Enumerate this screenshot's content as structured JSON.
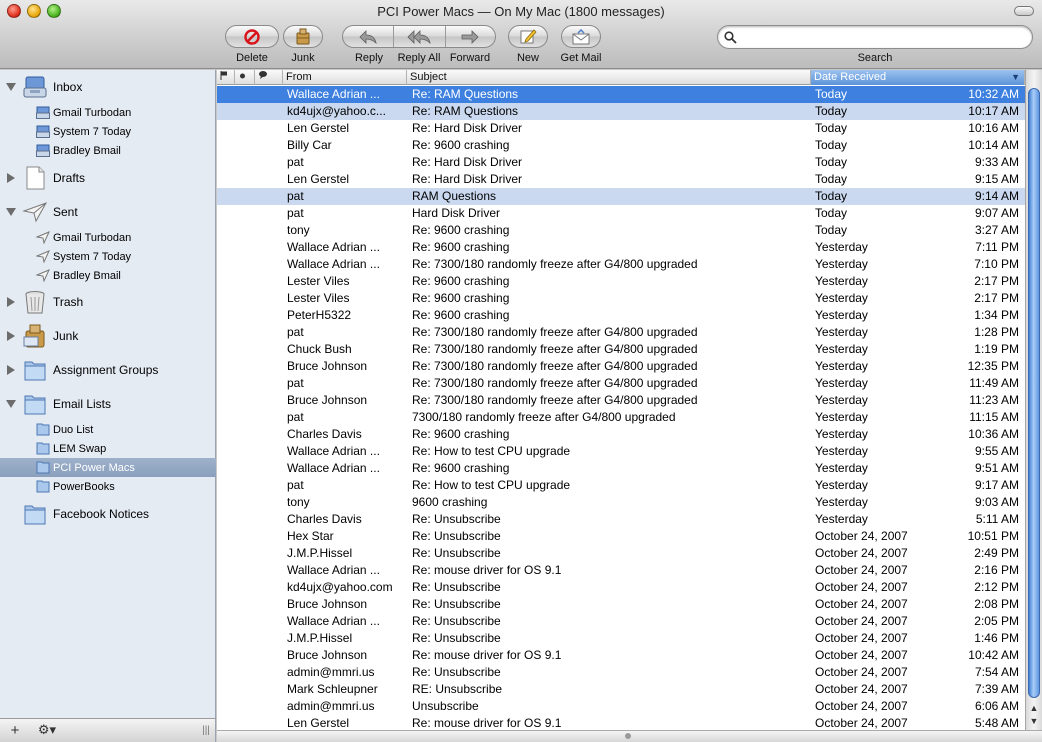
{
  "window": {
    "title": "PCI Power Macs — On My Mac (1800 messages)"
  },
  "toolbar": {
    "delete_label": "Delete",
    "junk_label": "Junk",
    "reply_label": "Reply",
    "reply_all_label": "Reply All",
    "forward_label": "Forward",
    "new_label": "New",
    "get_mail_label": "Get Mail",
    "search_label": "Search",
    "search_value": ""
  },
  "sidebar": {
    "inbox": "Inbox",
    "inbox_accounts": [
      "Gmail Turbodan",
      "System 7 Today",
      "Bradley Bmail"
    ],
    "drafts": "Drafts",
    "sent": "Sent",
    "sent_accounts": [
      "Gmail Turbodan",
      "System 7 Today",
      "Bradley Bmail"
    ],
    "trash": "Trash",
    "junk": "Junk",
    "assignment_groups": "Assignment Groups",
    "email_lists": "Email Lists",
    "email_list_items": [
      "Duo List",
      "LEM Swap",
      "PCI Power Macs",
      "PowerBooks"
    ],
    "selected_mailbox": "PCI Power Macs",
    "facebook_notices": "Facebook Notices"
  },
  "columns": {
    "from": "From",
    "subject": "Subject",
    "date_received": "Date Received"
  },
  "messages": [
    {
      "from": "Wallace Adrian ...",
      "subject": "Re: RAM Questions",
      "date": "Today",
      "time": "10:32 AM"
    },
    {
      "from": "kd4ujx@yahoo.c...",
      "subject": "Re: RAM Questions",
      "date": "Today",
      "time": "10:17 AM"
    },
    {
      "from": "Len Gerstel",
      "subject": "Re: Hard Disk Driver",
      "date": "Today",
      "time": "10:16 AM"
    },
    {
      "from": "Billy Car",
      "subject": "Re: 9600 crashing",
      "date": "Today",
      "time": "10:14 AM"
    },
    {
      "from": "pat",
      "subject": "Re: Hard Disk Driver",
      "date": "Today",
      "time": "9:33 AM"
    },
    {
      "from": "Len Gerstel",
      "subject": "Re: Hard Disk Driver",
      "date": "Today",
      "time": "9:15 AM"
    },
    {
      "from": "pat",
      "subject": "RAM Questions",
      "date": "Today",
      "time": "9:14 AM"
    },
    {
      "from": "pat",
      "subject": "Hard Disk Driver",
      "date": "Today",
      "time": "9:07 AM"
    },
    {
      "from": "tony",
      "subject": "Re: 9600 crashing",
      "date": "Today",
      "time": "3:27 AM"
    },
    {
      "from": "Wallace Adrian ...",
      "subject": "Re: 9600 crashing",
      "date": "Yesterday",
      "time": "7:11 PM"
    },
    {
      "from": "Wallace Adrian ...",
      "subject": "Re: 7300/180 randomly freeze after G4/800 upgraded",
      "date": "Yesterday",
      "time": "7:10 PM"
    },
    {
      "from": "Lester Viles",
      "subject": "Re: 9600 crashing",
      "date": "Yesterday",
      "time": "2:17 PM"
    },
    {
      "from": "Lester Viles",
      "subject": "Re: 9600 crashing",
      "date": "Yesterday",
      "time": "2:17 PM"
    },
    {
      "from": "PeterH5322",
      "subject": "Re: 9600 crashing",
      "date": "Yesterday",
      "time": "1:34 PM"
    },
    {
      "from": "pat",
      "subject": "Re: 7300/180 randomly freeze after G4/800 upgraded",
      "date": "Yesterday",
      "time": "1:28 PM"
    },
    {
      "from": "Chuck Bush",
      "subject": "Re: 7300/180 randomly freeze after G4/800 upgraded",
      "date": "Yesterday",
      "time": "1:19 PM"
    },
    {
      "from": "Bruce Johnson",
      "subject": "Re: 7300/180 randomly freeze after G4/800 upgraded",
      "date": "Yesterday",
      "time": "12:35 PM"
    },
    {
      "from": "pat",
      "subject": "Re: 7300/180 randomly freeze after G4/800 upgraded",
      "date": "Yesterday",
      "time": "11:49 AM"
    },
    {
      "from": "Bruce Johnson",
      "subject": "Re: 7300/180 randomly freeze after G4/800 upgraded",
      "date": "Yesterday",
      "time": "11:23 AM"
    },
    {
      "from": "pat",
      "subject": "7300/180 randomly freeze after G4/800 upgraded",
      "date": "Yesterday",
      "time": "11:15 AM"
    },
    {
      "from": "Charles Davis",
      "subject": "Re: 9600 crashing",
      "date": "Yesterday",
      "time": "10:36 AM"
    },
    {
      "from": "Wallace Adrian ...",
      "subject": "Re: How to test CPU upgrade",
      "date": "Yesterday",
      "time": "9:55 AM"
    },
    {
      "from": "Wallace Adrian ...",
      "subject": "Re: 9600 crashing",
      "date": "Yesterday",
      "time": "9:51 AM"
    },
    {
      "from": "pat",
      "subject": "Re: How to test CPU upgrade",
      "date": "Yesterday",
      "time": "9:17 AM"
    },
    {
      "from": "tony",
      "subject": "9600 crashing",
      "date": "Yesterday",
      "time": "9:03 AM"
    },
    {
      "from": "Charles Davis",
      "subject": "Re: Unsubscribe",
      "date": "Yesterday",
      "time": "5:11 AM"
    },
    {
      "from": "Hex Star",
      "subject": "Re: Unsubscribe",
      "date": "October 24, 2007",
      "time": "10:51 PM"
    },
    {
      "from": "J.M.P.Hissel",
      "subject": "Re: Unsubscribe",
      "date": "October 24, 2007",
      "time": "2:49 PM"
    },
    {
      "from": "Wallace Adrian ...",
      "subject": "Re: mouse driver for OS 9.1",
      "date": "October 24, 2007",
      "time": "2:16 PM"
    },
    {
      "from": "kd4ujx@yahoo.com",
      "subject": "Re: Unsubscribe",
      "date": "October 24, 2007",
      "time": "2:12 PM"
    },
    {
      "from": "Bruce Johnson",
      "subject": "Re: Unsubscribe",
      "date": "October 24, 2007",
      "time": "2:08 PM"
    },
    {
      "from": "Wallace Adrian ...",
      "subject": "Re: Unsubscribe",
      "date": "October 24, 2007",
      "time": "2:05 PM"
    },
    {
      "from": "J.M.P.Hissel",
      "subject": "Re: Unsubscribe",
      "date": "October 24, 2007",
      "time": "1:46 PM"
    },
    {
      "from": "Bruce Johnson",
      "subject": "Re: mouse driver for OS 9.1",
      "date": "October 24, 2007",
      "time": "10:42 AM"
    },
    {
      "from": "admin@mmri.us",
      "subject": "Re: Unsubscribe",
      "date": "October 24, 2007",
      "time": "7:54 AM"
    },
    {
      "from": "Mark Schleupner",
      "subject": "RE: Unsubscribe",
      "date": "October 24, 2007",
      "time": "7:39 AM"
    },
    {
      "from": "admin@mmri.us",
      "subject": "Unsubscribe",
      "date": "October 24, 2007",
      "time": "6:06 AM"
    },
    {
      "from": "Len Gerstel",
      "subject": "Re: mouse driver for OS 9.1",
      "date": "October 24, 2007",
      "time": "5:48 AM"
    }
  ],
  "selected_row": 0,
  "highlighted_rows": [
    1,
    6
  ]
}
